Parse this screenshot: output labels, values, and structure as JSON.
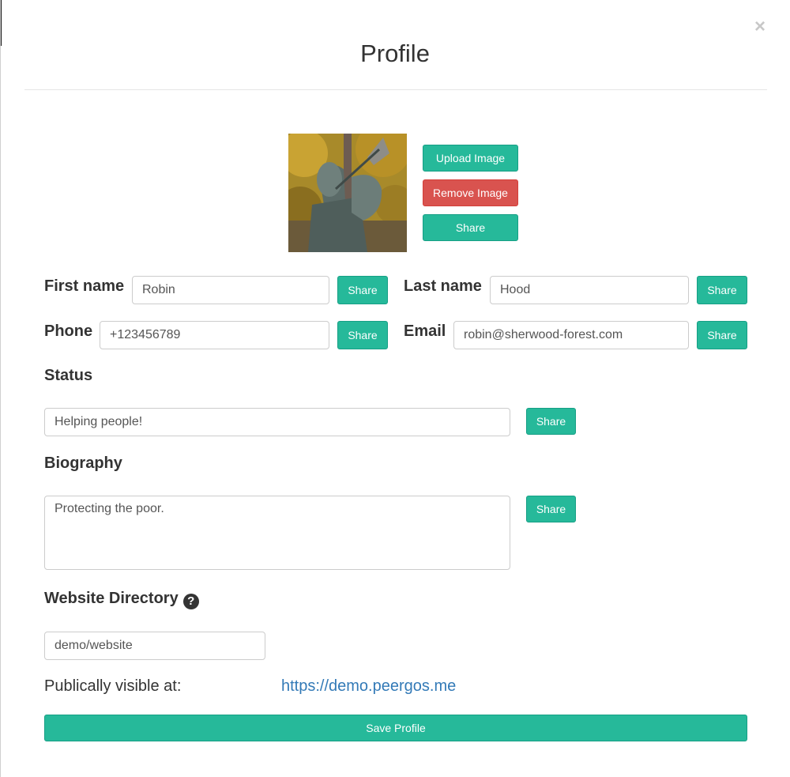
{
  "modal": {
    "title": "Profile",
    "close_label": "×"
  },
  "avatar_actions": {
    "upload_label": "Upload Image",
    "remove_label": "Remove Image",
    "share_label": "Share"
  },
  "fields": {
    "first_name": {
      "label": "First name",
      "value": "Robin",
      "share_label": "Share"
    },
    "last_name": {
      "label": "Last name",
      "value": "Hood",
      "share_label": "Share"
    },
    "phone": {
      "label": "Phone",
      "value": "+123456789",
      "share_label": "Share"
    },
    "email": {
      "label": "Email",
      "value": "robin@sherwood-forest.com",
      "share_label": "Share"
    },
    "status": {
      "label": "Status",
      "value": "Helping people!",
      "share_label": "Share"
    },
    "biography": {
      "label": "Biography",
      "value": "Protecting the poor.",
      "share_label": "Share"
    }
  },
  "website": {
    "label": "Website Directory",
    "help_icon": "question-circle-icon",
    "help_glyph": "?",
    "value": "demo/website",
    "visible_label": "Publically visible at:",
    "url": "https://demo.peergos.me"
  },
  "save_label": "Save Profile",
  "colors": {
    "primary": "#26b99a",
    "danger": "#d9534f",
    "link": "#337ab7"
  }
}
